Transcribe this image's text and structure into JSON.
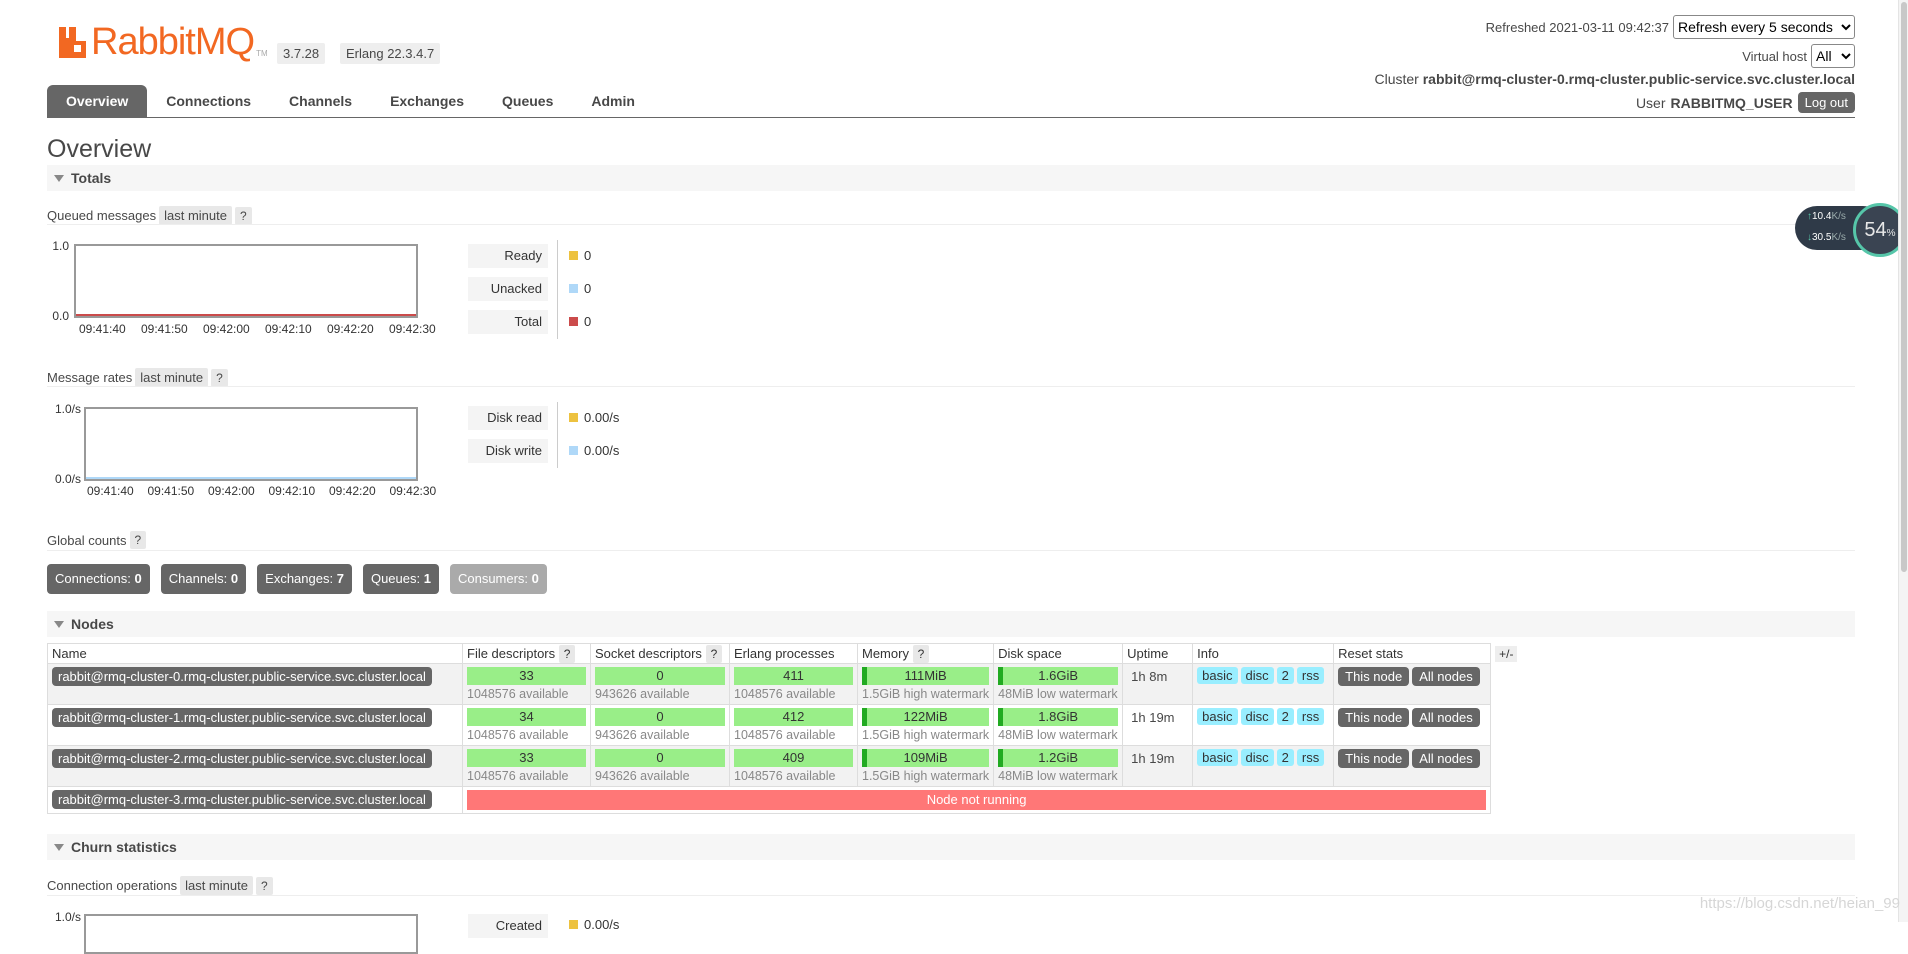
{
  "header": {
    "logo_text": "RabbitMQ",
    "tm": "TM",
    "version": "3.7.28",
    "erlang": "Erlang 22.3.4.7",
    "refreshed_label": "Refreshed 2021-03-11 09:42:37",
    "refresh_option": "Refresh every 5 seconds",
    "virtual_host_label": "Virtual host",
    "virtual_host_value": "All",
    "cluster_label": "Cluster",
    "cluster_value": "rabbit@rmq-cluster-0.rmq-cluster.public-service.svc.cluster.local",
    "user_label": "User",
    "user_value": "RABBITMQ_USER",
    "logout": "Log out"
  },
  "tabs": [
    {
      "label": "Overview"
    },
    {
      "label": "Connections"
    },
    {
      "label": "Channels"
    },
    {
      "label": "Exchanges"
    },
    {
      "label": "Queues"
    },
    {
      "label": "Admin"
    }
  ],
  "page_title": "Overview",
  "totals": {
    "section": "Totals",
    "queued": {
      "title": "Queued messages",
      "range": "last minute",
      "help": "?",
      "y_top": "1.0",
      "y_bottom": "0.0",
      "x_ticks": [
        "09:41:40",
        "09:41:50",
        "09:42:00",
        "09:42:10",
        "09:42:20",
        "09:42:30"
      ],
      "legend": [
        {
          "label": "Ready",
          "value": "0",
          "color": "#edc240"
        },
        {
          "label": "Unacked",
          "value": "0",
          "color": "#afd8f8"
        },
        {
          "label": "Total",
          "value": "0",
          "color": "#cb4b4b"
        }
      ]
    },
    "rates": {
      "title": "Message rates",
      "range": "last minute",
      "help": "?",
      "y_top": "1.0/s",
      "y_bottom": "0.0/s",
      "x_ticks": [
        "09:41:40",
        "09:41:50",
        "09:42:00",
        "09:42:10",
        "09:42:20",
        "09:42:30"
      ],
      "legend": [
        {
          "label": "Disk read",
          "value": "0.00/s",
          "color": "#edc240"
        },
        {
          "label": "Disk write",
          "value": "0.00/s",
          "color": "#afd8f8"
        }
      ]
    },
    "global": {
      "title": "Global counts",
      "help": "?",
      "counts": [
        {
          "label": "Connections:",
          "value": "0"
        },
        {
          "label": "Channels:",
          "value": "0"
        },
        {
          "label": "Exchanges:",
          "value": "7"
        },
        {
          "label": "Queues:",
          "value": "1"
        },
        {
          "label": "Consumers:",
          "value": "0"
        }
      ]
    }
  },
  "nodes": {
    "section": "Nodes",
    "columns": {
      "name": "Name",
      "fd": "File descriptors",
      "sd": "Socket descriptors",
      "ep": "Erlang processes",
      "mem": "Memory",
      "disk": "Disk space",
      "uptime": "Uptime",
      "info": "Info",
      "reset": "Reset stats",
      "plusminus": "+/-",
      "help": "?"
    },
    "rows": [
      {
        "name": "rabbit@rmq-cluster-0.rmq-cluster.public-service.svc.cluster.local",
        "fd": "33",
        "fd_avail": "1048576 available",
        "sd": "0",
        "sd_avail": "943626 available",
        "ep": "411",
        "ep_avail": "1048576 available",
        "mem": "111MiB",
        "mem_wm": "1.5GiB high watermark",
        "disk": "1.6GiB",
        "disk_wm": "48MiB low watermark",
        "uptime": "1h 8m",
        "info": [
          "basic",
          "disc",
          "2",
          "rss"
        ],
        "reset": [
          "This node",
          "All nodes"
        ]
      },
      {
        "name": "rabbit@rmq-cluster-1.rmq-cluster.public-service.svc.cluster.local",
        "fd": "34",
        "fd_avail": "1048576 available",
        "sd": "0",
        "sd_avail": "943626 available",
        "ep": "412",
        "ep_avail": "1048576 available",
        "mem": "122MiB",
        "mem_wm": "1.5GiB high watermark",
        "disk": "1.8GiB",
        "disk_wm": "48MiB low watermark",
        "uptime": "1h 19m",
        "info": [
          "basic",
          "disc",
          "2",
          "rss"
        ],
        "reset": [
          "This node",
          "All nodes"
        ]
      },
      {
        "name": "rabbit@rmq-cluster-2.rmq-cluster.public-service.svc.cluster.local",
        "fd": "33",
        "fd_avail": "1048576 available",
        "sd": "0",
        "sd_avail": "943626 available",
        "ep": "409",
        "ep_avail": "1048576 available",
        "mem": "109MiB",
        "mem_wm": "1.5GiB high watermark",
        "disk": "1.2GiB",
        "disk_wm": "48MiB low watermark",
        "uptime": "1h 19m",
        "info": [
          "basic",
          "disc",
          "2",
          "rss"
        ],
        "reset": [
          "This node",
          "All nodes"
        ]
      },
      {
        "name": "rabbit@rmq-cluster-3.rmq-cluster.public-service.svc.cluster.local",
        "not_running": "Node not running"
      }
    ]
  },
  "churn": {
    "section": "Churn statistics",
    "conn_ops": {
      "title": "Connection operations",
      "range": "last minute",
      "help": "?",
      "y_top": "1.0/s",
      "legend_first": "Created",
      "legend_first_value": "0.00/s"
    }
  },
  "net_widget": {
    "up": "10.4",
    "down": "30.5",
    "unit": "K/s",
    "percent": "54",
    "pct_sign": "%"
  },
  "watermark": "https://blog.csdn.net/heian_99"
}
